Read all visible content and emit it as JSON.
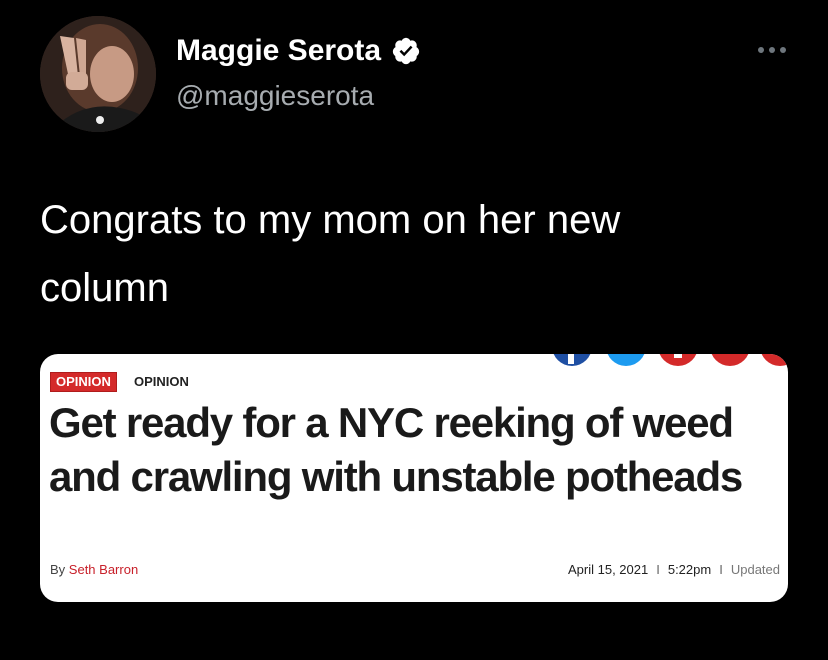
{
  "tweet": {
    "author": {
      "name": "Maggie Serota",
      "handle": "@maggieserota",
      "verified": true
    },
    "text": "Congrats to my mom on her new column",
    "icons": {
      "avatar": "avatar-photo",
      "verified": "verified-badge-icon",
      "more": "more-options-icon"
    }
  },
  "article_card": {
    "section_badge": "OPINION",
    "section_label": "OPINION",
    "headline": "Get ready for a NYC reeking of weed and crawling with unstable potheads",
    "byline_prefix": "By",
    "byline_author": "Seth Barron",
    "date": "April 15, 2021",
    "time": "5:22pm",
    "updated_label": "Updated",
    "separator": "I",
    "share_icons": [
      "facebook-icon",
      "twitter-icon",
      "flipboard-icon",
      "email-icon",
      "link-icon"
    ],
    "colors": {
      "badge": "#d42a2a",
      "byline_author": "#c8202a",
      "facebook": "#1f4fa3",
      "twitter": "#1d9bf0",
      "red_share": "#d42a2a"
    }
  }
}
